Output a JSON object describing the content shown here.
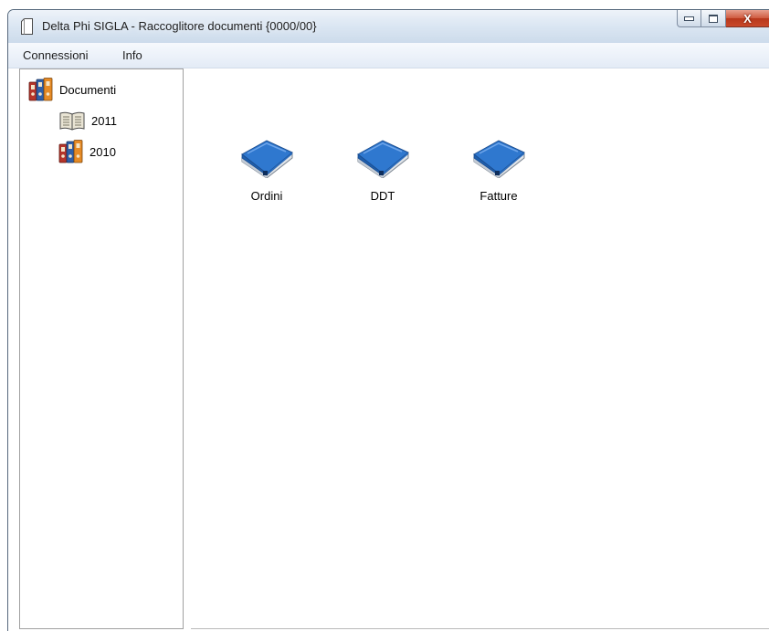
{
  "window": {
    "title": "Delta Phi SIGLA - Raccoglitore documenti {0000/00}",
    "close_glyph": "X"
  },
  "menu": {
    "items": [
      {
        "label": "Connessioni"
      },
      {
        "label": "Info"
      }
    ]
  },
  "tree": {
    "root": {
      "label": "Documenti",
      "icon": "binders-icon"
    },
    "children": [
      {
        "label": "2011",
        "icon": "open-book-icon"
      },
      {
        "label": "2010",
        "icon": "binders-icon"
      }
    ]
  },
  "folders": [
    {
      "label": "Ordini",
      "icon": "blue-book-icon"
    },
    {
      "label": "DDT",
      "icon": "blue-book-icon"
    },
    {
      "label": "Fatture",
      "icon": "blue-book-icon"
    }
  ],
  "colors": {
    "book_blue": "#2f78cf",
    "close_red": "#c9482a",
    "frame": "#cfdcea"
  }
}
